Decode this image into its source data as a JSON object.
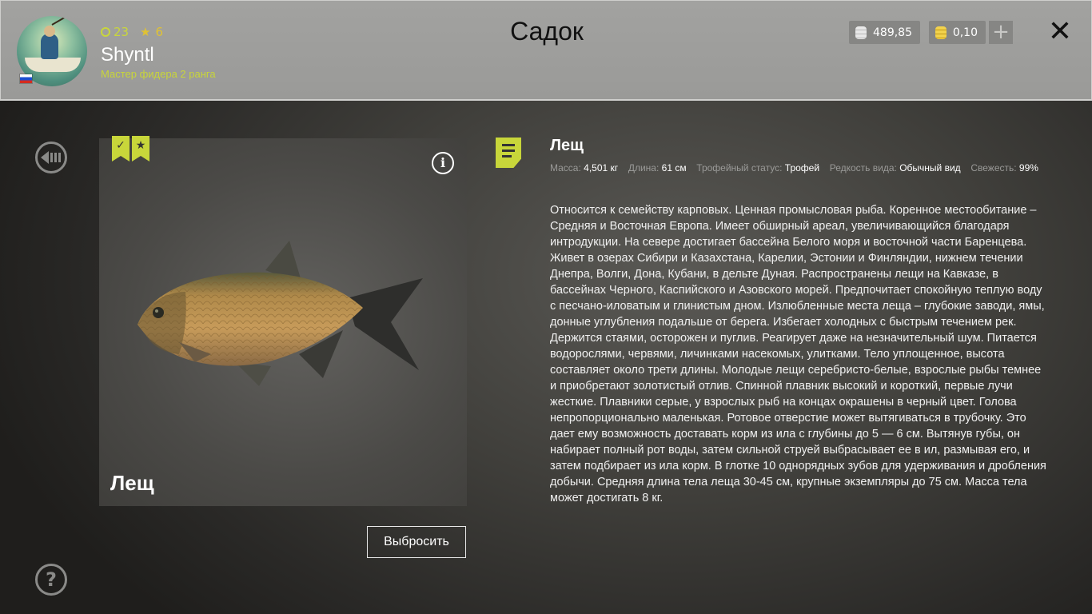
{
  "header": {
    "player": {
      "level": "23",
      "stars": "6",
      "name": "Shyntl",
      "rank": "Мастер фидера 2 ранга"
    },
    "title": "Садок",
    "wallet": {
      "silver": "489,85",
      "gold": "0,10",
      "add_label": "+"
    },
    "close_label": "✕"
  },
  "nav": {
    "help_label": "?"
  },
  "fish_card": {
    "name": "Лещ",
    "info_label": "i",
    "discard_label": "Выбросить"
  },
  "details": {
    "title": "Лещ",
    "meta": {
      "mass_label": "Масса:",
      "mass_value": "4,501 кг",
      "length_label": "Длина:",
      "length_value": "61 см",
      "trophy_label": "Трофейный статус:",
      "trophy_value": "Трофей",
      "rarity_label": "Редкость вида:",
      "rarity_value": "Обычный вид",
      "fresh_label": "Свежесть:",
      "fresh_value": "99%"
    },
    "description": "Относится к семейству карповых. Ценная промысловая рыба. Коренное местообитание – Средняя и Восточная Европа. Имеет обширный ареал, увеличивающийся благодаря интродукции. На севере достигает бассейна Белого моря и восточной части Баренцева. Живет в озерах Сибири и Казахстана, Карелии, Эстонии и Финляндии, нижнем течении Днепра, Волги, Дона, Кубани, в дельте Дуная. Распространены лещи на Кавказе, в бассейнах Черного, Каспийского и Азовского морей. Предпочитает спокойную теплую воду с песчано-иловатым и глинистым дном. Излюбленные места леща – глубокие заводи, ямы, донные углубления подальше от берега. Избегает холодных с быстрым течением рек. Держится стаями, осторожен и пуглив. Реагирует даже на незначительный шум.  Питается водорослями, червями, личинками насекомых, улитками. Тело уплощенное, высота составляет около трети длины. Молодые лещи серебристо-белые, взрослые рыбы темнее и приобретают золотистый отлив. Спинной плавник высокий и короткий, первые лучи жесткие. Плавники серые, у взрослых рыб на концах окрашены в черный цвет. Голова непропорционально маленькая. Ротовое отверстие может вытягиваться в трубочку. Это дает ему возможность доставать корм из ила с глубины до 5 — 6 см. Вытянув губы, он набирает полный рот воды, затем сильной струей выбрасывает ее в ил, размывая его, и затем подбирает из ила корм. В глотке 10 однорядных зубов для удерживания и дробления добычи. Средняя длина тела леща 30-45 см, крупные экземпляры до 75 см. Масса тела может достигать 8 кг."
  },
  "colors": {
    "accent": "#c8d63a",
    "gold": "#e0c233"
  }
}
